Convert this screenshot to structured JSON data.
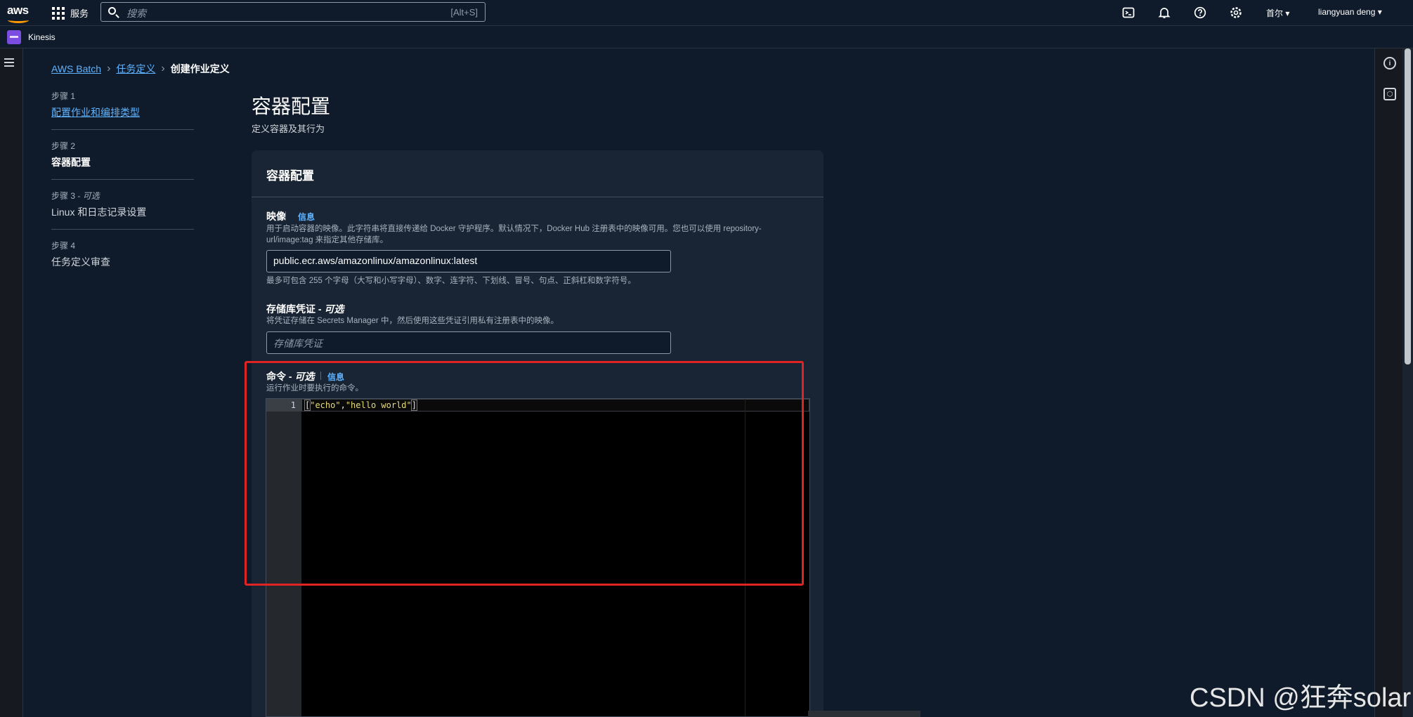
{
  "topnav": {
    "logo": "aws",
    "services_label": "服务",
    "search_placeholder": "搜索",
    "search_shortcut": "[Alt+S]",
    "region": "首尔 ▾",
    "user": "liangyuan deng ▾",
    "icons": [
      "cloudshell-icon",
      "bell-icon",
      "help-icon",
      "settings-icon"
    ]
  },
  "subnav": {
    "service": "Kinesis"
  },
  "breadcrumb": {
    "item1": "AWS Batch",
    "item2": "任务定义",
    "current": "创建作业定义"
  },
  "steps": [
    {
      "label": "步骤 1",
      "optional": "",
      "title": "配置作业和编排类型",
      "state": "link"
    },
    {
      "label": "步骤 2",
      "optional": "",
      "title": "容器配置",
      "state": "active"
    },
    {
      "label": "步骤 3 - ",
      "optional": "可选",
      "title": "Linux 和日志记录设置",
      "state": "normal"
    },
    {
      "label": "步骤 4",
      "optional": "",
      "title": "任务定义审查",
      "state": "normal"
    }
  ],
  "page": {
    "title": "容器配置",
    "description": "定义容器及其行为"
  },
  "panel": {
    "title": "容器配置",
    "image": {
      "label": "映像",
      "info": "信息",
      "description": "用于启动容器的映像。此字符串将直接传递给 Docker 守护程序。默认情况下，Docker Hub 注册表中的映像可用。您也可以使用 repository-url/image:tag 来指定其他存储库。",
      "value": "public.ecr.aws/amazonlinux/amazonlinux:latest",
      "constraint": "最多可包含 255 个字母（大写和小写字母）、数字、连字符、下划线、冒号、句点、正斜杠和数字符号。"
    },
    "credentials": {
      "label": "存储库凭证 - ",
      "optional": "可选",
      "description": "将凭证存储在 Secrets Manager 中，然后使用这些凭证引用私有注册表中的映像。",
      "placeholder": "存储库凭证"
    },
    "command": {
      "label": "命令 - ",
      "optional": "可选",
      "info": "信息",
      "description": "运行作业时要执行的命令。",
      "line_number": "1",
      "code_open": "[",
      "code_str1": "\"echo\"",
      "code_comma": ",",
      "code_str2": "\"hello world\"",
      "code_close": "]"
    }
  },
  "watermark": "CSDN @狂奔solar",
  "colors": {
    "accent": "#5fb3ff",
    "highlight": "#e02424",
    "brand": "#ff9900"
  }
}
